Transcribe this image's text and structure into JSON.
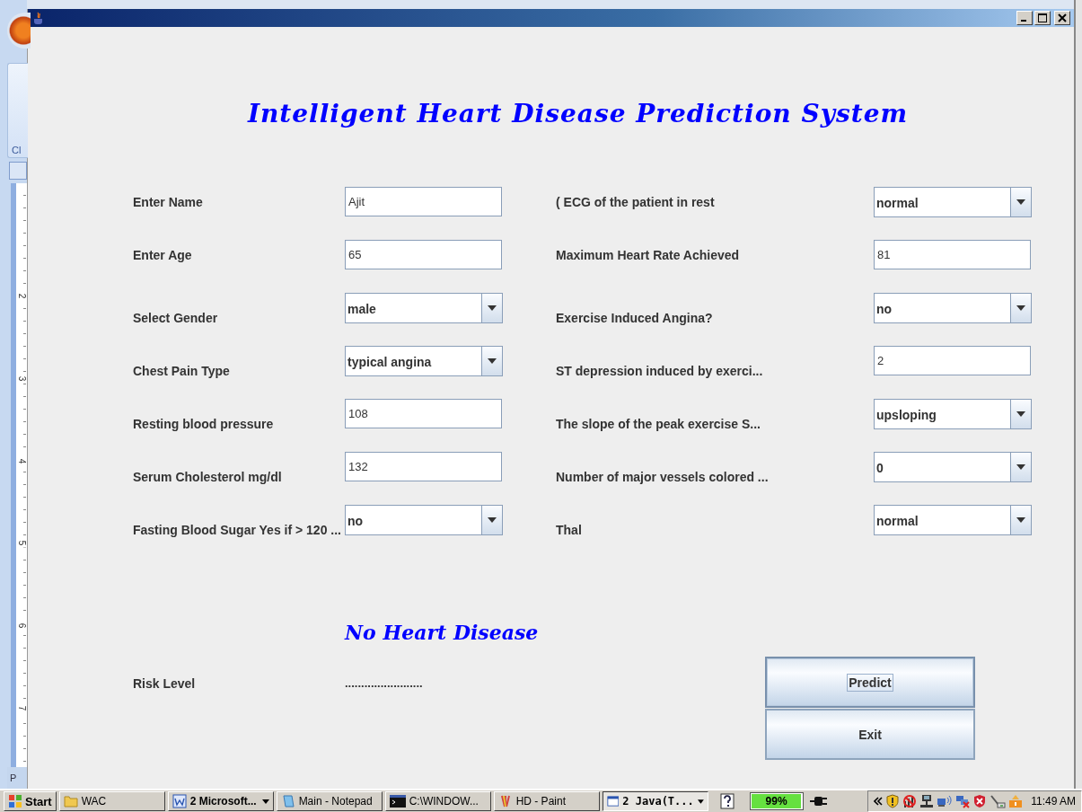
{
  "background_app": {
    "ribbon_text": "Cl",
    "pane_text": "P",
    "ruler_labels": [
      "2",
      "3",
      "4",
      "5",
      "6",
      "7"
    ]
  },
  "heading": "Intelligent Heart Disease Prediction System",
  "left_fields": [
    {
      "label": "Enter  Name",
      "kind": "text",
      "value": "Ajit"
    },
    {
      "label": "Enter  Age",
      "kind": "text",
      "value": "65"
    },
    {
      "label": "Select Gender",
      "kind": "combo",
      "value": "male"
    },
    {
      "label": "Chest Pain Type",
      "kind": "combo",
      "value": "typical angina"
    },
    {
      "label": "Resting blood pressure",
      "kind": "text",
      "value": "108"
    },
    {
      "label": "Serum Cholesterol mg/dl",
      "kind": "text",
      "value": "132"
    },
    {
      "label": "Fasting Blood Sugar Yes if > 120 ...",
      "kind": "combo",
      "value": "no"
    }
  ],
  "right_fields": [
    {
      "label": "( ECG of the patient in rest",
      "kind": "combo",
      "value": "normal"
    },
    {
      "label": "Maximum Heart Rate Achieved",
      "kind": "text",
      "value": "81"
    },
    {
      "label": "Exercise Induced Angina?",
      "kind": "combo",
      "value": "no"
    },
    {
      "label": "ST depression induced by exerci...",
      "kind": "text",
      "value": "2"
    },
    {
      "label": "The slope of the peak exercise S...",
      "kind": "combo",
      "value": "upsloping"
    },
    {
      "label": "Number of major vessels colored ...",
      "kind": "combo",
      "value": "0"
    },
    {
      "label": "Thal",
      "kind": "combo",
      "value": "normal"
    }
  ],
  "result": "No Heart Disease",
  "risk": {
    "label": "Risk Level",
    "value": "........................"
  },
  "buttons": [
    {
      "label": "Predict",
      "focused": true
    },
    {
      "label": "Exit",
      "focused": false
    }
  ],
  "taskbar": {
    "start": "Start",
    "tasks": [
      {
        "label": "WAC",
        "kind": "folder",
        "selected": false,
        "has_menu": false
      },
      {
        "label": "2 Microsoft...",
        "kind": "word",
        "selected": false,
        "has_menu": true
      },
      {
        "label": "Main - Notepad",
        "kind": "notepad",
        "selected": false,
        "has_menu": false
      },
      {
        "label": "C:\\WINDOW...",
        "kind": "console",
        "selected": false,
        "has_menu": false
      },
      {
        "label": "HD - Paint",
        "kind": "paint",
        "selected": false,
        "has_menu": false
      },
      {
        "label": "2 Java(T...",
        "kind": "window",
        "selected": true,
        "has_menu": true
      }
    ],
    "battery": {
      "level": 0.99,
      "reading": "99%"
    },
    "clock": "11:49 AM"
  }
}
